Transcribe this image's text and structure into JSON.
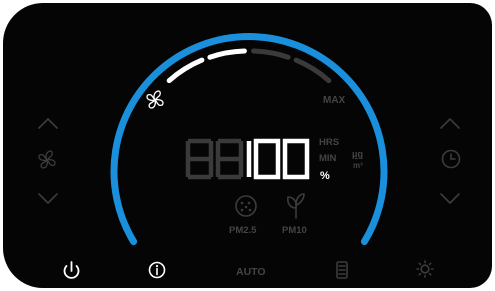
{
  "gauge": {
    "max_label": "MAX",
    "ring_color": "#1a8fdc",
    "fan_level": 2,
    "fan_level_total": 4
  },
  "display": {
    "dim_digits": "88",
    "value": "100",
    "units_inactive": [
      "HRS",
      "MIN"
    ],
    "unit_concentration_top": "μg",
    "unit_concentration_bottom": "m³",
    "active_unit": "%"
  },
  "sensors": {
    "pm25_label": "PM2.5",
    "pm10_label": "PM10"
  },
  "left_controls": {
    "up_icon": "chevron-up-icon",
    "fan_icon": "fan-icon",
    "down_icon": "chevron-down-icon"
  },
  "right_controls": {
    "up_icon": "chevron-up-icon",
    "timer_icon": "clock-icon",
    "down_icon": "chevron-down-icon"
  },
  "bottom_bar": {
    "power_icon": "power-icon",
    "info_icon": "info-icon",
    "auto_label": "AUTO",
    "filter_icon": "filter-icon",
    "light_icon": "brightness-icon"
  }
}
